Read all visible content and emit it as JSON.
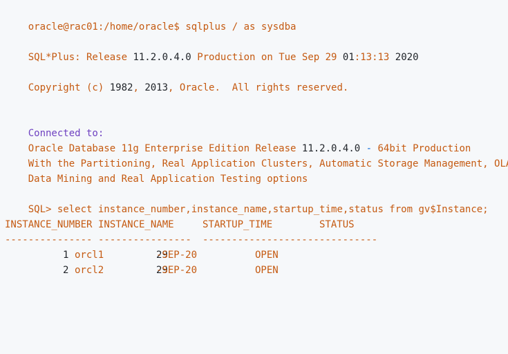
{
  "prompt": {
    "user_host_path": "oracle@rac01:/home/oracle$",
    "command": "sqlplus / as sysdba"
  },
  "banner": {
    "prefix": "SQL*Plus: Release",
    "version": "11.2.0.4.0",
    "middle": "Production on Tue Sep 29",
    "time_hour": "01",
    "time_rest": ":13:13",
    "year": "2020"
  },
  "copyright": {
    "prefix": "Copyright (c)",
    "year_from": "1982",
    "year_to": "2013",
    "suffix": ", Oracle.  All rights reserved."
  },
  "connection": {
    "connected_label": "Connected to:",
    "db_prefix": "Oracle Database 11g Enterprise Edition Release",
    "db_version": "11.2.0.4.0",
    "db_dash": "-",
    "db_suffix": "64bit Production",
    "options_line1": "With the Partitioning, Real Application Clusters, Automatic Storage Management, OLAP,",
    "options_line2": "Data Mining and Real Application Testing options"
  },
  "query": {
    "prompt": "SQL>",
    "text": "select instance_number,instance_name,startup_time,status from gv$Instance;"
  },
  "table": {
    "headers": [
      "INSTANCE_NUMBER",
      "INSTANCE_NAME",
      "STARTUP_TIME",
      "STATUS"
    ],
    "separators": [
      "---------------",
      "----------------",
      "------------------",
      "------------"
    ],
    "rows": [
      {
        "number": "1",
        "name": "orcl1",
        "date_day": "29",
        "date_rest": "-SEP-20",
        "status": "OPEN"
      },
      {
        "number": "2",
        "name": "orcl2",
        "date_day": "29",
        "date_rest": "-SEP-20",
        "status": "OPEN"
      }
    ]
  }
}
